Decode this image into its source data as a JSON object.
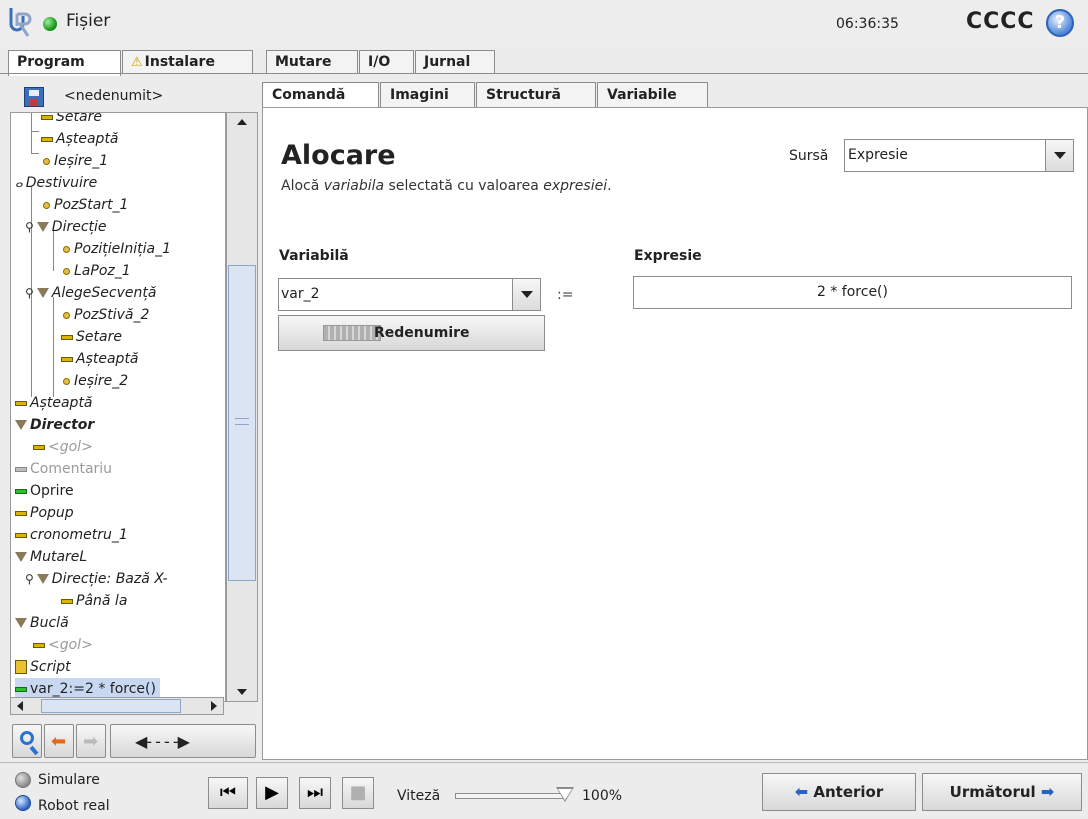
{
  "header": {
    "file_menu": "Fișier",
    "clock": "06:36:35",
    "robot_name": "CCCC",
    "help_icon": "?"
  },
  "main_tabs": [
    "Program",
    "Instalare",
    "Mutare",
    "I/O",
    "Jurnal"
  ],
  "program": {
    "name": "<nedenumit>"
  },
  "tree": [
    "Setare",
    "Așteaptă",
    "Ieșire_1",
    "Destivuire",
    "PozStart_1",
    "Direcție",
    "PozițieInițiа_1",
    "LaPoz_1",
    "AlegeSecvență",
    "PozStivă_2",
    "Setare",
    "Așteaptă",
    "Ieșire_2",
    "Așteaptă",
    "Director",
    "<gol>",
    "Comentariu",
    "Oprire",
    "Popup",
    "cronometru_1",
    "MutareL",
    "Direcție: Bază X-",
    "Până la",
    "Buclă",
    "<gol>",
    "Script",
    "var_2:=2 * force()"
  ],
  "sub_tabs": [
    "Comandă",
    "Imagini",
    "Structură",
    "Variabile"
  ],
  "assignment": {
    "title": "Alocare",
    "desc_pre": "Alocă ",
    "desc_var": "variabila",
    "desc_mid": " selectată cu valoarea ",
    "desc_expr": "expresiei",
    "desc_end": ".",
    "source_label": "Sursă",
    "source_value": "Expresie",
    "variable_label": "Variabilă",
    "variable_value": "var_2",
    "assign_symbol": ":=",
    "expression_label": "Expresie",
    "expression_value": "2 * force()",
    "rename_label": "Redenumire"
  },
  "bottom": {
    "simulation": "Simulare",
    "real_robot": "Robot real",
    "speed_label": "Viteză",
    "speed_value": "100%",
    "speed_fraction": 1.0,
    "prev": "Anterior",
    "next": "Următorul"
  },
  "colors": {
    "accent": "#2a62c0",
    "status_green": "#1e9a1e"
  }
}
